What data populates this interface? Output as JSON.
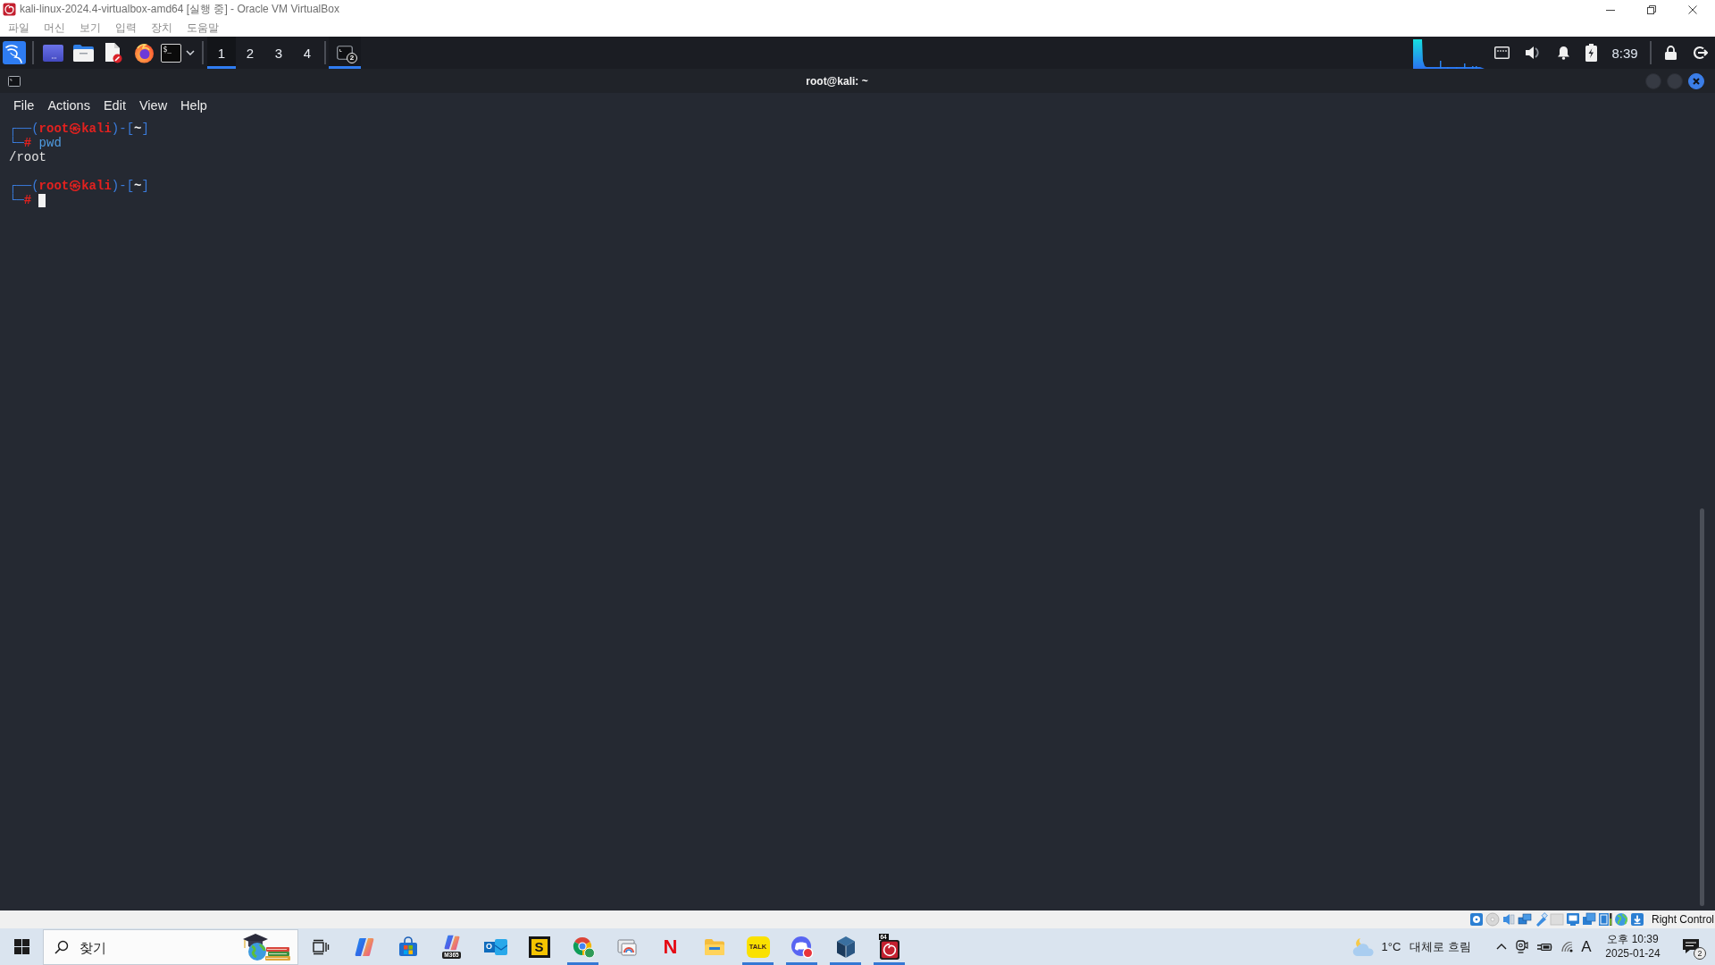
{
  "vm_window": {
    "title": "kali-linux-2024.4-virtualbox-amd64 [실행 중] - Oracle VM VirtualBox",
    "menu": [
      "파일",
      "머신",
      "보기",
      "입력",
      "장치",
      "도움말"
    ]
  },
  "panel": {
    "terminal_launcher": "$_",
    "workspaces": [
      {
        "label": "1",
        "selected": true
      },
      {
        "label": "2",
        "selected": false
      },
      {
        "label": "3",
        "selected": false
      },
      {
        "label": "4",
        "selected": false
      }
    ],
    "tasks": [
      {
        "badge": "2",
        "selected": true
      }
    ],
    "clock": "8:39"
  },
  "terminal": {
    "title": "root@kali: ~",
    "menu": [
      "File",
      "Actions",
      "Edit",
      "View",
      "Help"
    ],
    "lines": [
      {
        "kind": "prompt",
        "cursor": false,
        "top": [
          {
            "kind": "frame",
            "text": "┌──("
          },
          {
            "kind": "user",
            "text": "root㉿kali"
          },
          {
            "kind": "frame",
            "text": ")-["
          },
          {
            "kind": "path",
            "text": "~"
          },
          {
            "kind": "frame",
            "text": "]"
          }
        ],
        "bottom": [
          {
            "kind": "frame",
            "text": "└─"
          },
          {
            "kind": "sign",
            "text": "#"
          },
          {
            "kind": "command",
            "text": " pwd"
          }
        ]
      },
      {
        "kind": "output",
        "text": "/root"
      },
      {
        "kind": "blank"
      },
      {
        "kind": "prompt",
        "cursor": true,
        "top": [
          {
            "kind": "frame",
            "text": "┌──("
          },
          {
            "kind": "user",
            "text": "root㉿kali"
          },
          {
            "kind": "frame",
            "text": ")-["
          },
          {
            "kind": "path",
            "text": "~"
          },
          {
            "kind": "frame",
            "text": "]"
          }
        ],
        "bottom": [
          {
            "kind": "frame",
            "text": "└─"
          },
          {
            "kind": "sign",
            "text": "#"
          }
        ]
      }
    ]
  },
  "vm_status_bar": {
    "host_key": "Right Control"
  },
  "taskbar": {
    "search": {
      "placeholder": "찾기"
    },
    "apps": [
      {
        "kind": "task_view",
        "running": false
      },
      {
        "kind": "copilot",
        "running": false
      },
      {
        "kind": "store",
        "running": false
      },
      {
        "kind": "m365",
        "label": "M365",
        "running": false
      },
      {
        "kind": "outlook",
        "label": "O",
        "running": false
      },
      {
        "kind": "letter_tile",
        "label": "S",
        "running": false
      },
      {
        "kind": "chrome",
        "running": true
      },
      {
        "kind": "snip",
        "running": false
      },
      {
        "kind": "letter_logo",
        "label": "N",
        "running": false
      },
      {
        "kind": "explorer",
        "running": false
      },
      {
        "kind": "talk",
        "label": "TALK",
        "running": true
      },
      {
        "kind": "chat",
        "running": true
      },
      {
        "kind": "cube",
        "running": true
      },
      {
        "kind": "vm_swirl",
        "label": "64",
        "running": true
      }
    ],
    "weather": {
      "temperature": "1°C",
      "condition": "대체로 흐림"
    },
    "input_indicator": "A",
    "time": "오후 10:39",
    "date": "2025-01-24",
    "notifications": "2"
  }
}
